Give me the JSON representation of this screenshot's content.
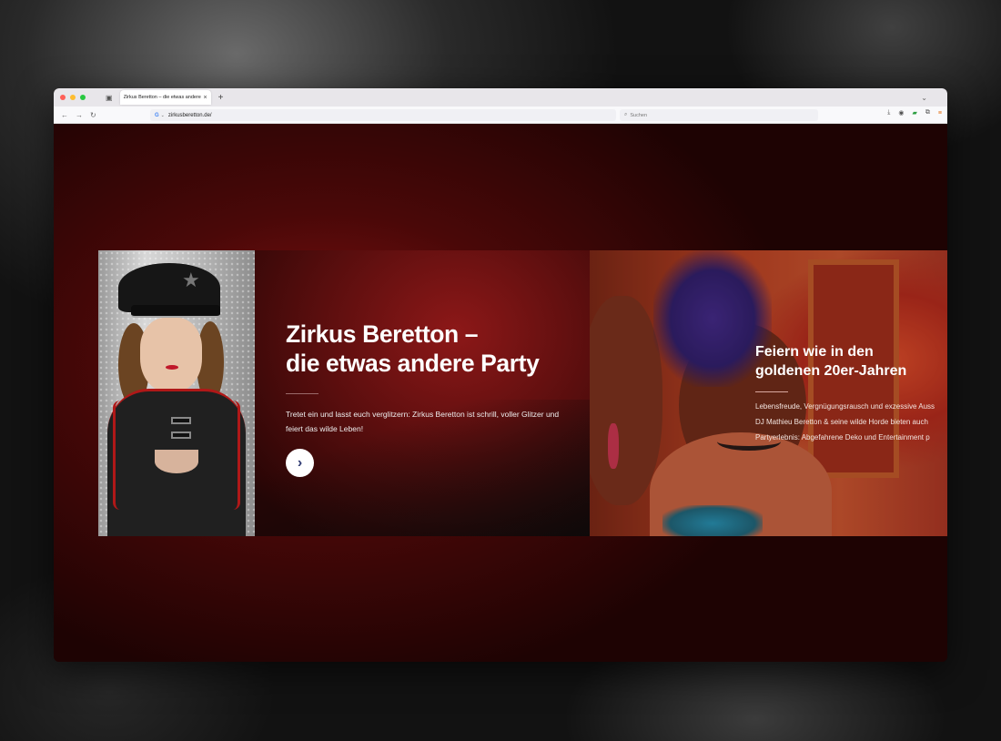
{
  "browser": {
    "tab_title": "Zirkus Beretton – die etwas andere",
    "tab_close": "×",
    "new_tab": "+",
    "url": "zirkusberetton.de/",
    "search_placeholder": "Suchen",
    "search_engine_letter": "G"
  },
  "hero": {
    "title_line1": "Zirkus Beretton –",
    "title_line2": "die etwas andere Party",
    "text": "Tretet ein und lasst euch verglitzern: Zirkus Beretton ist schrill, voller Glitzer und feiert das wilde Leben!",
    "button_icon": "chevron-right-icon",
    "button_glyph": "›"
  },
  "feature": {
    "title_line1": "Feiern wie in den",
    "title_line2": "goldenen 20er-Jahren",
    "text_line1": "Lebensfreude, Vergnügungsrausch und exzessive Auss",
    "text_line2": "DJ Mathieu Beretton & seine wilde Horde bieten auch",
    "text_line3": "Partyerlebnis: Abgefahrene Deko und Entertainment p"
  },
  "colors": {
    "accent_red": "#8a1212",
    "button_icon": "#2f3b73"
  }
}
